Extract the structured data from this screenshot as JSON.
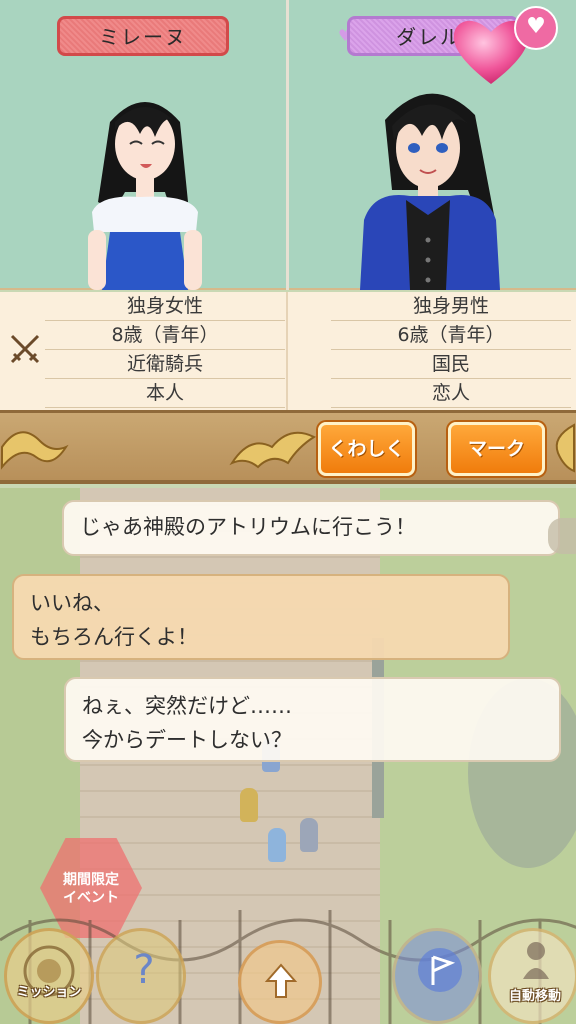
{
  "left_character": {
    "name": "ミレーヌ",
    "info": [
      "独身女性",
      "8歳（青年）",
      "近衛騎兵",
      "本人"
    ]
  },
  "right_character": {
    "name": "ダレル",
    "info": [
      "独身男性",
      "6歳（青年）",
      "国民",
      "恋人"
    ]
  },
  "buttons": {
    "details": "くわしく",
    "mark": "マーク"
  },
  "dialogue": [
    {
      "lines": [
        "じゃあ神殿のアトリウムに行こう！"
      ]
    },
    {
      "lines": [
        "いいね、",
        "もちろん行くよ！"
      ]
    },
    {
      "lines": [
        "ねぇ、突然だけど……",
        "今からデートしない？"
      ]
    }
  ],
  "event_badge": [
    "期間限定",
    "イベント"
  ],
  "nav": {
    "mission": "ミッション",
    "auto_move": "自動移動"
  },
  "colors": {
    "portrait_bg": "#a9d4bf",
    "left_name_tag": "#e97a7a",
    "right_name_tag": "#cf93e0",
    "button_orange": "#f07c0c",
    "ornament_bar": "#b8905a"
  },
  "icons": [
    "crossed-swords-icon",
    "heart-icon",
    "question-icon",
    "up-arrow-icon",
    "flag-icon",
    "auto-move-icon",
    "mission-emblem-icon"
  ]
}
